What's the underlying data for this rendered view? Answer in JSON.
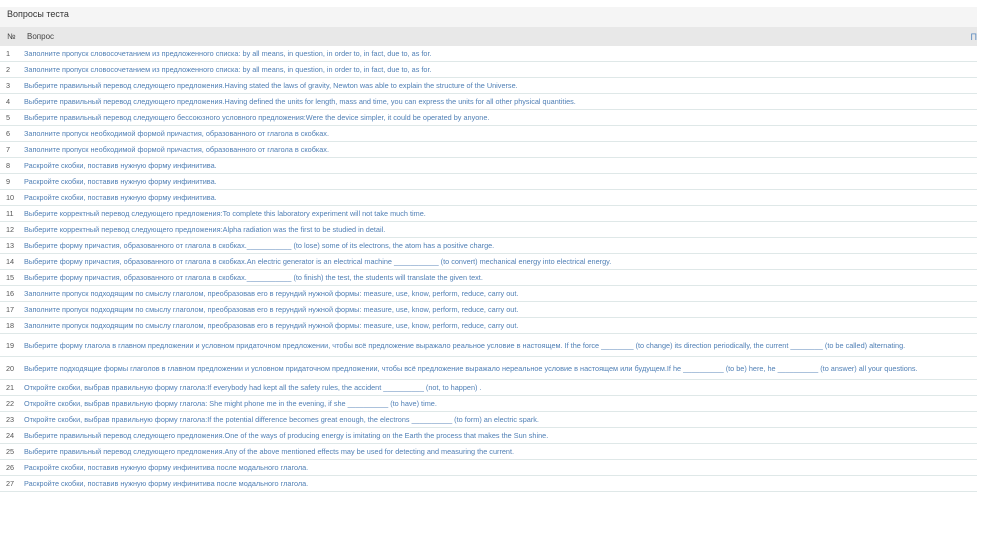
{
  "panel": {
    "title": "Вопросы теста"
  },
  "table": {
    "col_num": "№",
    "col_question": "Вопрос",
    "col_extra": "П"
  },
  "questions": [
    {
      "n": "1",
      "text": "Заполните пропуск словосочетанием из предложенного списка: by all means, in question, in order to, in fact, due to, as for."
    },
    {
      "n": "2",
      "text": "Заполните пропуск словосочетанием из предложенного списка: by all means, in question, in order to, in fact, due to, as for."
    },
    {
      "n": "3",
      "text": "Выберите правильный перевод следующего предложения.Having stated the laws of gravity, Newton was able to explain the structure of the Universe."
    },
    {
      "n": "4",
      "text": "Выберите правильный перевод следующего предложения.Having defined the units for length, mass and time, you can express the units for all other physical quantities."
    },
    {
      "n": "5",
      "text": "Выберите правильный перевод следующего бессоюзного условного предложения:Were the device simpler, it could be operated by anyone."
    },
    {
      "n": "6",
      "text": "Заполните пропуск необходимой формой причастия, образованного от глагола в скобках."
    },
    {
      "n": "7",
      "text": "Заполните пропуск необходимой формой причастия, образованного от глагола в скобках."
    },
    {
      "n": "8",
      "text": "Раскройте скобки, поставив нужную форму инфинитива."
    },
    {
      "n": "9",
      "text": "Раскройте скобки, поставив нужную форму инфинитива."
    },
    {
      "n": "10",
      "text": "Раскройте скобки, поставив нужную форму инфинитива."
    },
    {
      "n": "11",
      "text": "Выберите корректный перевод следующего предложения:To complete this laboratory experiment will not take much time."
    },
    {
      "n": "12",
      "text": "Выберите корректный перевод следующего предложения:Alpha radiation was the first to be studied in detail."
    },
    {
      "n": "13",
      "text": "Выберите форму причастия, образованного от глагола в скобках.___________ (to lose) some of its electrons, the atom has a positive charge."
    },
    {
      "n": "14",
      "text": "Выберите форму причастия, образованного от глагола в скобках.An electric generator is an electrical machine ___________ (to convert) mechanical energy into electrical energy."
    },
    {
      "n": "15",
      "text": "Выберите форму причастия, образованного от глагола в скобках.___________ (to finish) the test, the students will translate the given text."
    },
    {
      "n": "16",
      "text": "Заполните пропуск подходящим по смыслу глаголом, преобразовав его в герундий нужной формы: measure, use, know, perform, reduce, carry out."
    },
    {
      "n": "17",
      "text": "Заполните пропуск подходящим по смыслу глаголом, преобразовав его в герундий нужной формы: measure, use, know, perform, reduce, carry out."
    },
    {
      "n": "18",
      "text": "Заполните пропуск подходящим по смыслу глаголом, преобразовав его в герундий нужной формы: measure, use, know, perform, reduce, carry out."
    },
    {
      "n": "19",
      "text": "Выберите форму глагола в главном предложении и условном придаточном предложении, чтобы всё предложение выражало реальное условие в настоящем. If the force ________ (to change) its direction periodically, the current ________ (to be called) alternating."
    },
    {
      "n": "20",
      "text": "Выберите подходящие формы глаголов в главном предложении и условном придаточном предложении, чтобы всё предложение выражало нереальное условие в настоящем или будущем.If he __________ (to be) here, he __________ (to answer) all your questions."
    },
    {
      "n": "21",
      "text": "Откройте скобки, выбрав правильную форму глагола:If everybody had kept all the safety rules, the accident __________ (not, to happen) ."
    },
    {
      "n": "22",
      "text": "Откройте скобки, выбрав правильную форму глагола: She might phone me in the evening, if she __________ (to have) time."
    },
    {
      "n": "23",
      "text": "Откройте скобки, выбрав правильную форму глагола:If the potential difference becomes great enough, the electrons __________ (to form) an electric spark."
    },
    {
      "n": "24",
      "text": "Выберите правильный перевод следующего предложения.One of the ways of producing energy is imitating on the Earth the process that makes the Sun shine."
    },
    {
      "n": "25",
      "text": "Выберите правильный перевод следующего предложения.Any of the above mentioned effects may be used for detecting and measuring the current."
    },
    {
      "n": "26",
      "text": "Раскройте скобки, поставив нужную форму инфинитива после модального глагола."
    },
    {
      "n": "27",
      "text": "Раскройте скобки, поставив нужную форму инфинитива после модального глагола."
    }
  ]
}
